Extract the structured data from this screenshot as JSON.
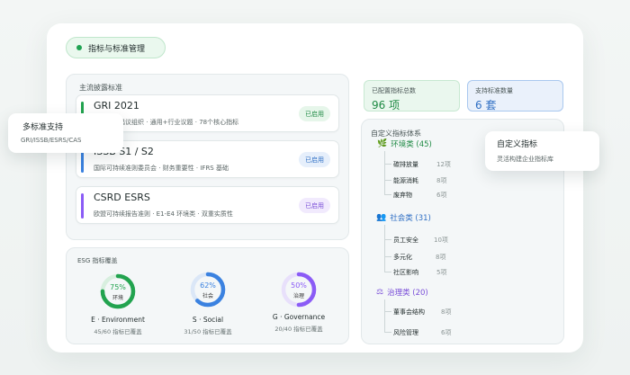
{
  "header": {
    "title": "指标与标准管理"
  },
  "standards": {
    "section_title": "主流披露标准",
    "items": [
      {
        "name": "GRI 2021",
        "desc": "全球报告倡议组织 · 通用+行业议题 · 78个核心指标",
        "status": "已启用",
        "color": "#22a34f",
        "badge_bg": "#e6f6ea",
        "badge_fg": "#1f8a44"
      },
      {
        "name": "ISSB S1 / S2",
        "desc": "国际可持续准则委员会 · 财务重要性 · IFRS 基础",
        "status": "已启用",
        "color": "#3b82e0",
        "badge_bg": "#e6effb",
        "badge_fg": "#2f6fc4"
      },
      {
        "name": "CSRD ESRS",
        "desc": "欧盟可持续报告准则 · E1-E4 环境类 · 双重实质性",
        "status": "已启用",
        "color": "#8b5cf6",
        "badge_bg": "#f1eafd",
        "badge_fg": "#7a4fd8"
      }
    ]
  },
  "coverage": {
    "section_title": "ESG 指标覆盖",
    "gauges": [
      {
        "pct": "75%",
        "value": 0.75,
        "short": "环境",
        "label": "E · Environment",
        "sub": "45/60 指标已覆盖",
        "color": "#22a34f",
        "track": "#d8efdf"
      },
      {
        "pct": "62%",
        "value": 0.62,
        "short": "社会",
        "label": "S · Social",
        "sub": "31/50 指标已覆盖",
        "color": "#3b82e0",
        "track": "#dbe7f7"
      },
      {
        "pct": "50%",
        "value": 0.5,
        "short": "治理",
        "label": "G · Governance",
        "sub": "20/40 指标已覆盖",
        "color": "#8b5cf6",
        "track": "#e8e0fb"
      }
    ]
  },
  "stats": {
    "total_label": "已配置指标总数",
    "total_value": "96 项",
    "std_label": "支持标准数量",
    "std_value": "6 套"
  },
  "custom": {
    "section_title": "自定义指标体系",
    "categories": [
      {
        "icon": "🌿",
        "name": "环境类 (45)",
        "color": "#1f8a44",
        "items": [
          {
            "name": "碳排放量",
            "count": "12项"
          },
          {
            "name": "能源消耗",
            "count": "8项"
          },
          {
            "name": "废弃物",
            "count": "6项"
          }
        ]
      },
      {
        "icon": "👥",
        "name": "社会类 (31)",
        "color": "#2f6fc4",
        "items": [
          {
            "name": "员工安全",
            "count": "10项"
          },
          {
            "name": "多元化",
            "count": "8项"
          },
          {
            "name": "社区影响",
            "count": "5项"
          }
        ]
      },
      {
        "icon": "⚖",
        "name": "治理类 (20)",
        "color": "#7a4fd8",
        "items": [
          {
            "name": "董事会结构",
            "count": "8项"
          },
          {
            "name": "风险管理",
            "count": "6项"
          }
        ]
      }
    ]
  },
  "float_multi": {
    "title": "多标准支持",
    "sub": "GRI/ISSB/ESRS/CAS"
  },
  "float_custom": {
    "title": "自定义指标",
    "sub": "灵活构建企业指标库"
  }
}
